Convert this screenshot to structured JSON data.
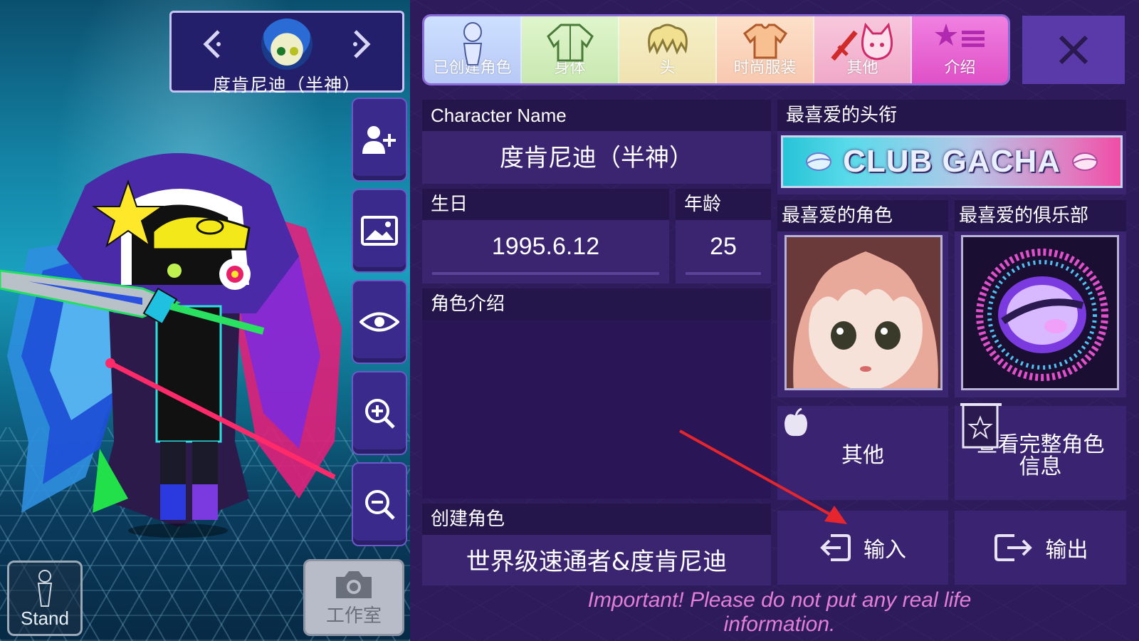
{
  "character": {
    "header_name": "度肯尼迪（半神）"
  },
  "left_tools": {
    "stand_label": "Stand",
    "studio_label": "工作室"
  },
  "tabs": [
    {
      "label": "已创建角色",
      "icon": "person-outline-icon"
    },
    {
      "label": "身体",
      "icon": "shirt-outline-icon"
    },
    {
      "label": "头",
      "icon": "hair-icon"
    },
    {
      "label": "时尚服装",
      "icon": "tshirt-icon"
    },
    {
      "label": "其他",
      "icon": "sword-cat-icon"
    },
    {
      "label": "介绍",
      "icon": "star-list-icon"
    }
  ],
  "profile": {
    "name_header": "Character Name",
    "name_value": "度肯尼迪（半神）",
    "birthday_header": "生日",
    "birthday_value": "1995.6.12",
    "age_header": "年龄",
    "age_value": "25",
    "intro_header": "角色介绍",
    "intro_value": "",
    "creator_header": "创建角色",
    "creator_value": "世界级速通者&度肯尼迪",
    "fav_title_header": "最喜爱的头衔",
    "fav_title_value": "CLUB GACHA",
    "fav_character_header": "最喜爱的角色",
    "fav_club_header": "最喜爱的俱乐部"
  },
  "actions": {
    "other_label": "其他",
    "view_full_label": "查看完整角色信息",
    "import_label": "输入",
    "export_label": "输出"
  },
  "warning": "Important! Please do not put any real life information.",
  "colors": {
    "panel_bg": "#2d1b5c",
    "box_bg": "#3b2470",
    "header_bg": "#24154b",
    "warning_pink": "#e37fd6",
    "arrow_red": "#e5262e"
  }
}
